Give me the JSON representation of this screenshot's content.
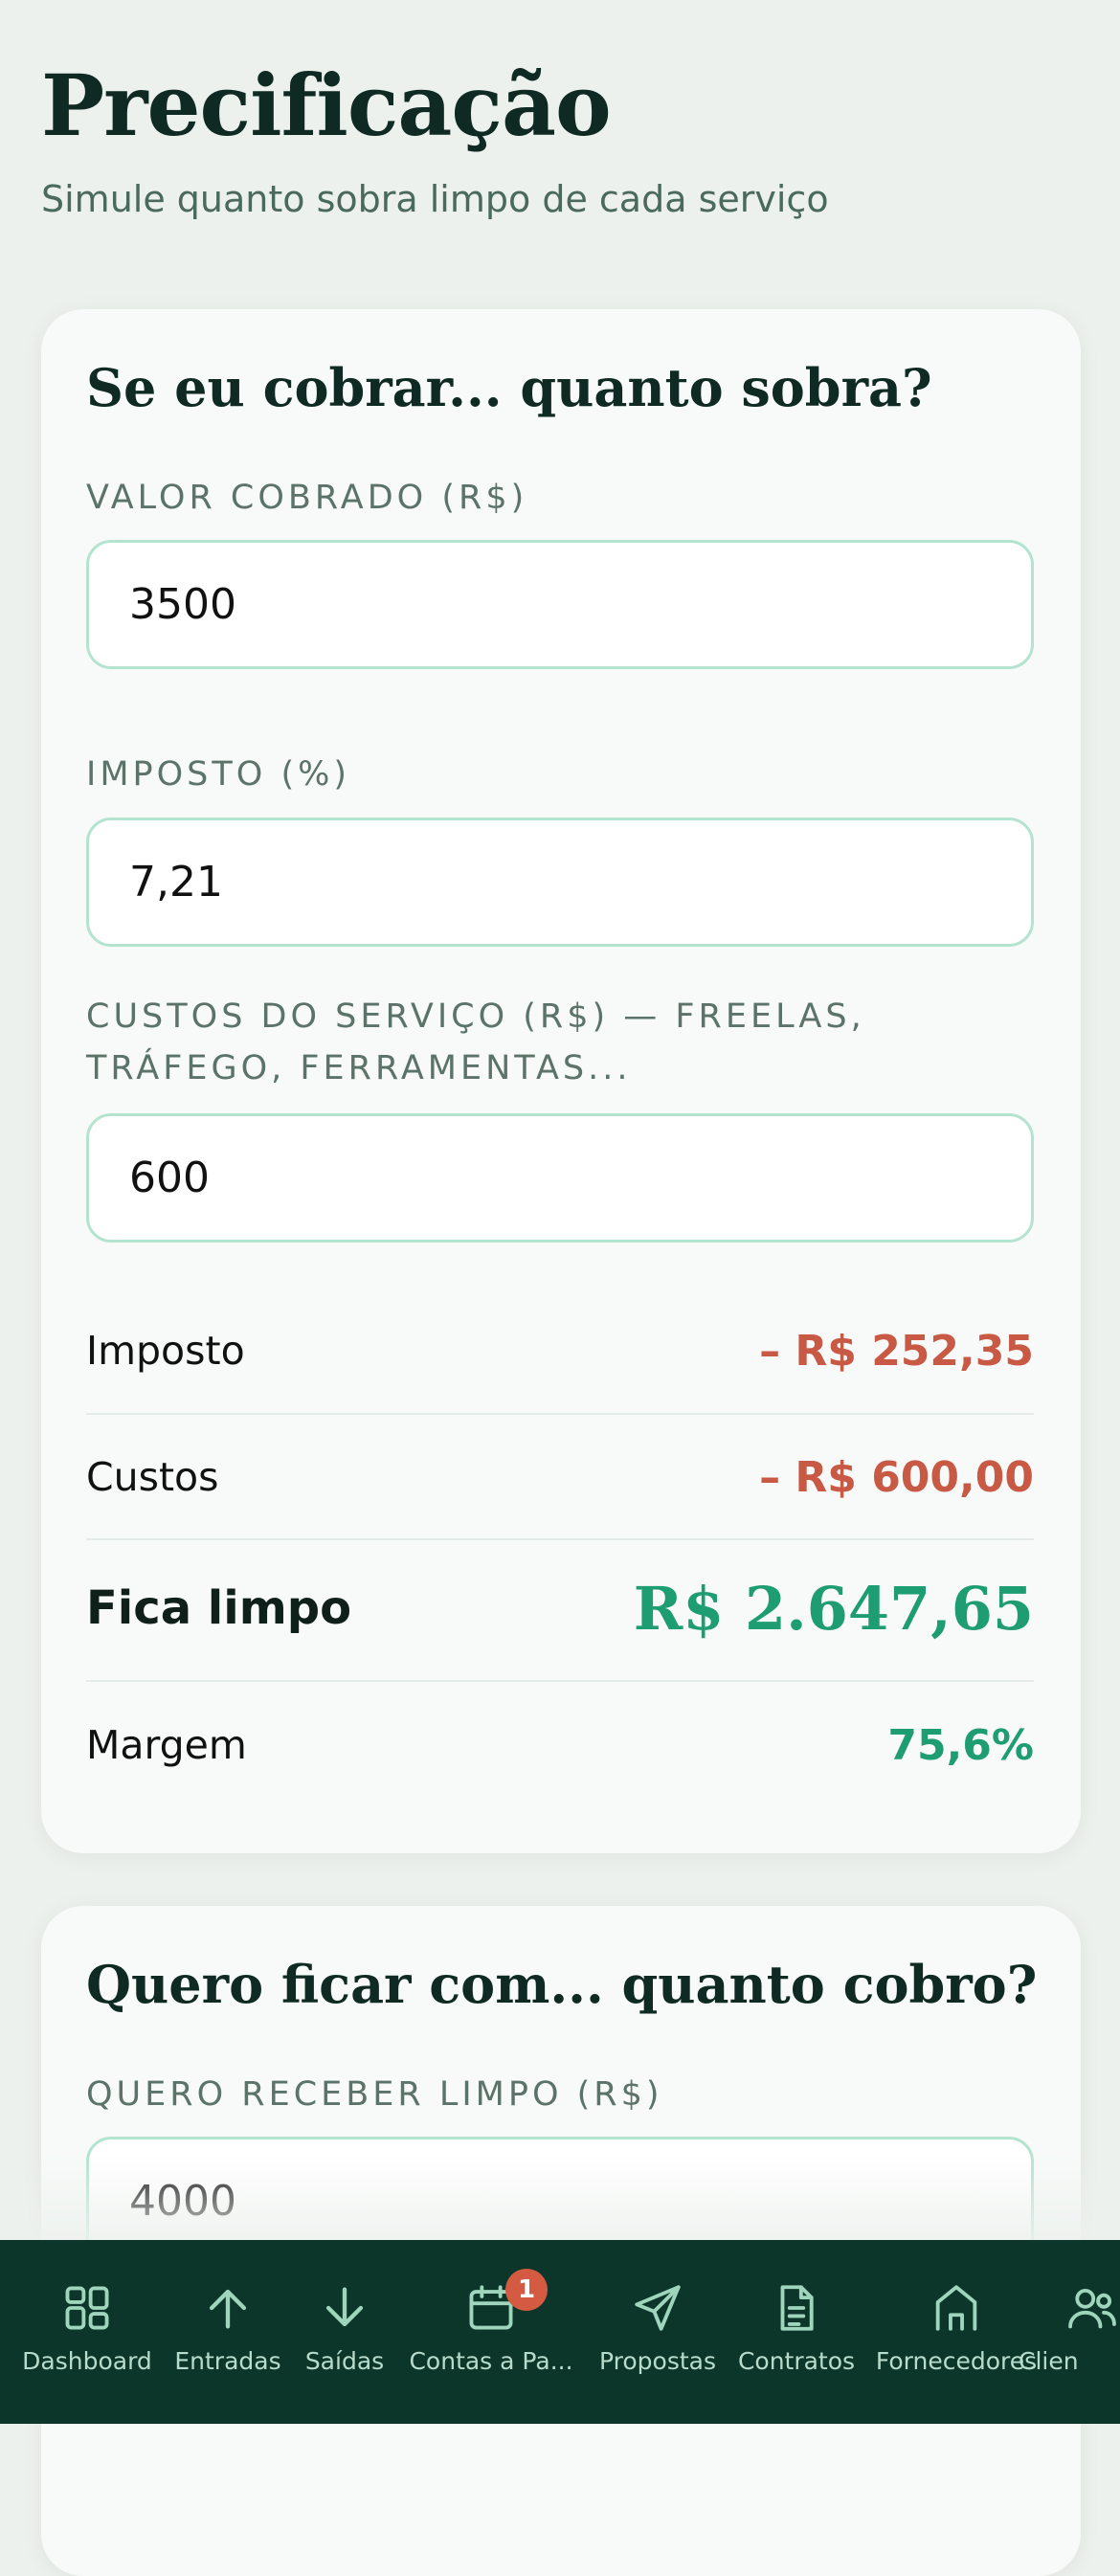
{
  "page": {
    "title": "Precificação",
    "subtitle": "Simule quanto sobra limpo de cada serviço"
  },
  "card1": {
    "title": "Se eu cobrar... quanto sobra?",
    "fields": [
      {
        "label": "VALOR COBRADO (R$)",
        "value": "3500"
      },
      {
        "label": "IMPOSTO (%)",
        "value": "7,21"
      },
      {
        "label": "CUSTOS DO SERVIÇO (R$) — FREELAS, TRÁFEGO, FERRAMENTAS...",
        "value": "600"
      }
    ],
    "results": {
      "imposto_label": "Imposto",
      "imposto_value": "– R$ 252,35",
      "custos_label": "Custos",
      "custos_value": "– R$ 600,00",
      "limpo_label": "Fica limpo",
      "limpo_value": "R$ 2.647,65",
      "margem_label": "Margem",
      "margem_value": "75,6%"
    }
  },
  "card2": {
    "title": "Quero ficar com... quanto cobro?",
    "fields": [
      {
        "label": "QUERO RECEBER LIMPO (R$)",
        "value": "4000"
      }
    ]
  },
  "nav": {
    "items": [
      {
        "label": "Dashboard",
        "icon": "dashboard-grid-icon"
      },
      {
        "label": "Entradas",
        "icon": "arrow-up-icon"
      },
      {
        "label": "Saídas",
        "icon": "arrow-down-icon"
      },
      {
        "label": "Contas a Pa...",
        "icon": "calendar-icon",
        "badge": "1"
      },
      {
        "label": "Propostas",
        "icon": "send-icon"
      },
      {
        "label": "Contratos",
        "icon": "document-icon"
      },
      {
        "label": "Fornecedores",
        "icon": "store-icon"
      },
      {
        "label": "Clien",
        "icon": "users-icon"
      }
    ]
  },
  "colors": {
    "accent_green": "#1f9d72",
    "negative_red": "#c85a45",
    "nav_background": "#0d362b",
    "input_border": "#b4e3d0",
    "badge_red": "#d55a42"
  }
}
